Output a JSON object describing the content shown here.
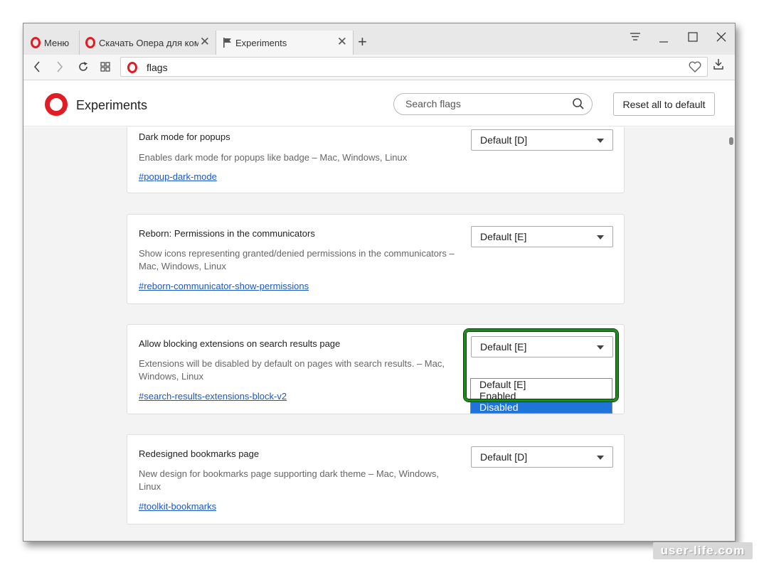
{
  "tabs": [
    {
      "label": "Меню"
    },
    {
      "label": "Скачать Опера для компь",
      "close": "✕"
    },
    {
      "label": "Experiments",
      "close": "✕"
    }
  ],
  "new_tab_label": "+",
  "address": {
    "url": "flags"
  },
  "header": {
    "title": "Experiments",
    "search_placeholder": "Search flags",
    "reset_label": "Reset all to default"
  },
  "flags": [
    {
      "title": "Dark mode for popups",
      "description": "Enables dark mode for popups like badge – Mac, Windows, Linux",
      "link": "#popup-dark-mode",
      "value": "Default [D]"
    },
    {
      "title": "Reborn: Permissions in the communicators",
      "description": "Show icons representing granted/denied permissions in the communicators – Mac, Windows, Linux",
      "link": "#reborn-communicator-show-permissions",
      "value": "Default [E]"
    },
    {
      "title": "Allow blocking extensions on search results page",
      "description": "Extensions will be disabled by default on pages with search results. – Mac, Windows, Linux",
      "link": "#search-results-extensions-block-v2",
      "value": "Default [E]",
      "options": [
        "Default [E]",
        "Enabled",
        "Disabled"
      ],
      "highlighted_option": "Disabled"
    },
    {
      "title": "Redesigned bookmarks page",
      "description": "New design for bookmarks page supporting dark theme – Mac, Windows, Linux",
      "link": "#toolkit-bookmarks",
      "value": "Default [D]"
    }
  ],
  "watermark": "user-life.com",
  "colors": {
    "opera_red": "#e21c24",
    "link_blue": "#1a57c7",
    "selection_blue": "#1e74d8",
    "highlight_green": "#1e8a1e"
  }
}
